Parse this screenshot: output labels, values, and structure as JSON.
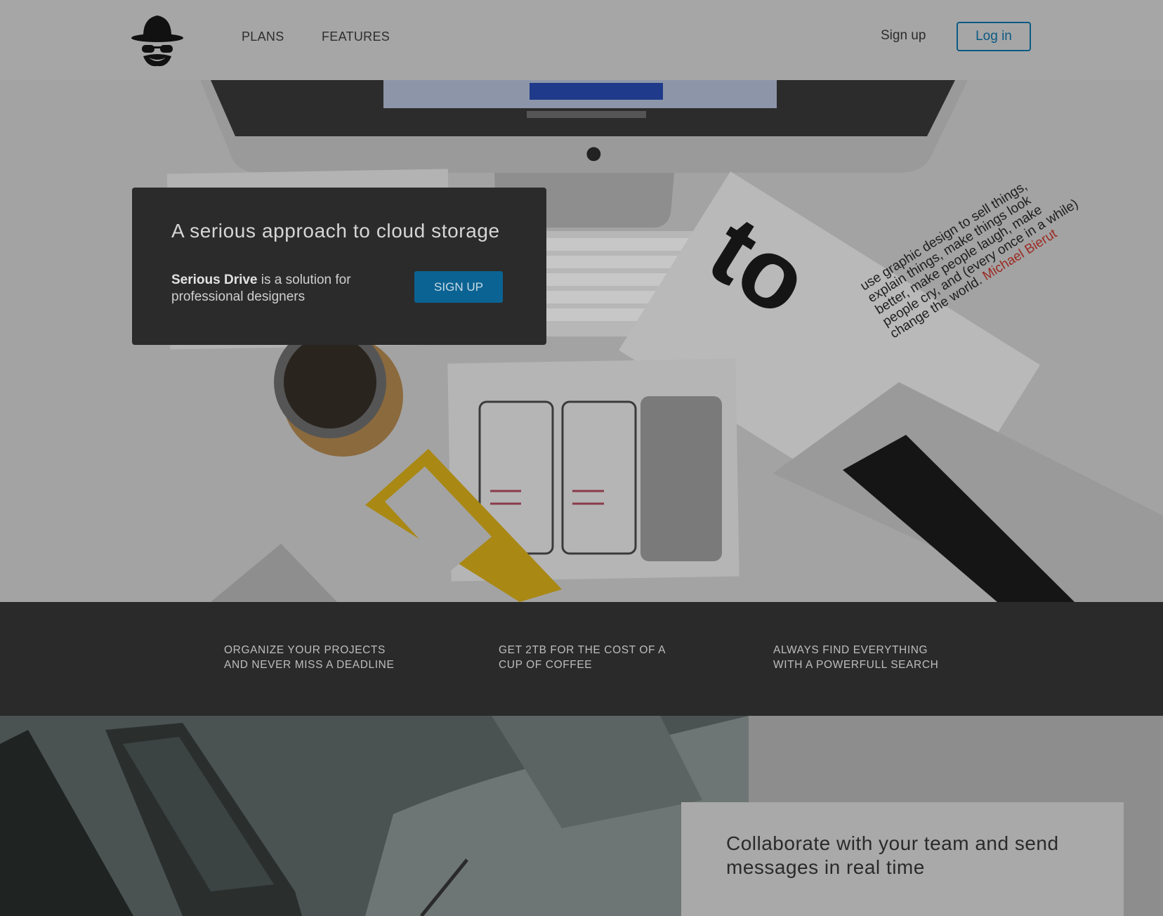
{
  "header": {
    "logo_alt": "spy-logo",
    "nav": [
      "PLANS",
      "FEATURES"
    ],
    "signup_label": "Sign up",
    "login_label": "Log in",
    "accent_color": "#0b5a85"
  },
  "hero": {
    "title": "A serious approach to cloud storage",
    "desc_bold": "Serious Drive",
    "desc_rest": " is a solution for professional designers",
    "cta_label": "SIGN UP",
    "book_text": "use graphic design to sell things, explain things, make things look better, make people laugh, make people cry, and (every once in a while) change the world.",
    "book_author": "Michael Bierut",
    "book_big": "to"
  },
  "features": [
    "ORGANIZE YOUR PROJECTS AND NEVER MISS A DEADLINE",
    "GET 2TB FOR THE COST OF A CUP OF COFFEE",
    "ALWAYS FIND EVERYTHING WITH A POWERFULL SEARCH"
  ],
  "collab": {
    "text": "Collaborate with your team and send messages in real time"
  }
}
